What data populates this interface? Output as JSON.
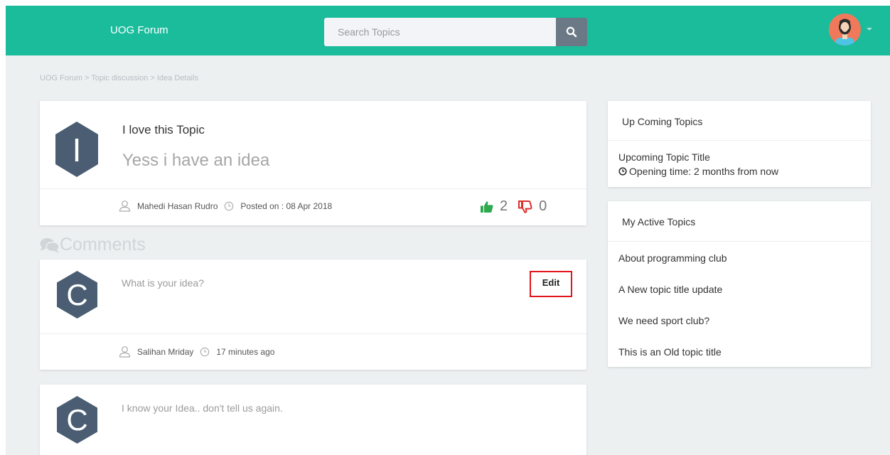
{
  "header": {
    "brand": "UOG Forum",
    "search_placeholder": "Search Topics"
  },
  "breadcrumb": "UOG Forum > Topic discussion > Idea Details",
  "post": {
    "avatar_letter": "I",
    "title": "I love this Topic",
    "body": "Yess i have an idea",
    "author": "Mahedi Hasan Rudro",
    "posted_on": "Posted on : 08 Apr 2018",
    "likes": "2",
    "dislikes": "0"
  },
  "comments_heading": "Comments",
  "comments": [
    {
      "avatar_letter": "C",
      "text": "What is your idea?",
      "edit_label": "Edit",
      "author": "Salihan Mriday",
      "time": "17 minutes ago"
    },
    {
      "avatar_letter": "C",
      "text": "I know your Idea.. don't tell us again."
    }
  ],
  "upcoming": {
    "heading": "Up Coming Topics",
    "title": "Upcoming Topic Title",
    "opening": "Opening time: 2 months from now"
  },
  "active": {
    "heading": "My Active Topics",
    "items": [
      "About programming club",
      "A New topic title update",
      "We need sport club?",
      "This is an Old topic title"
    ]
  },
  "colors": {
    "header": "#1abc9c",
    "avatar_hex": "#4a5d72",
    "like": "#2fa84f",
    "dislike": "#d9302a",
    "edit_border": "#e3141b"
  }
}
